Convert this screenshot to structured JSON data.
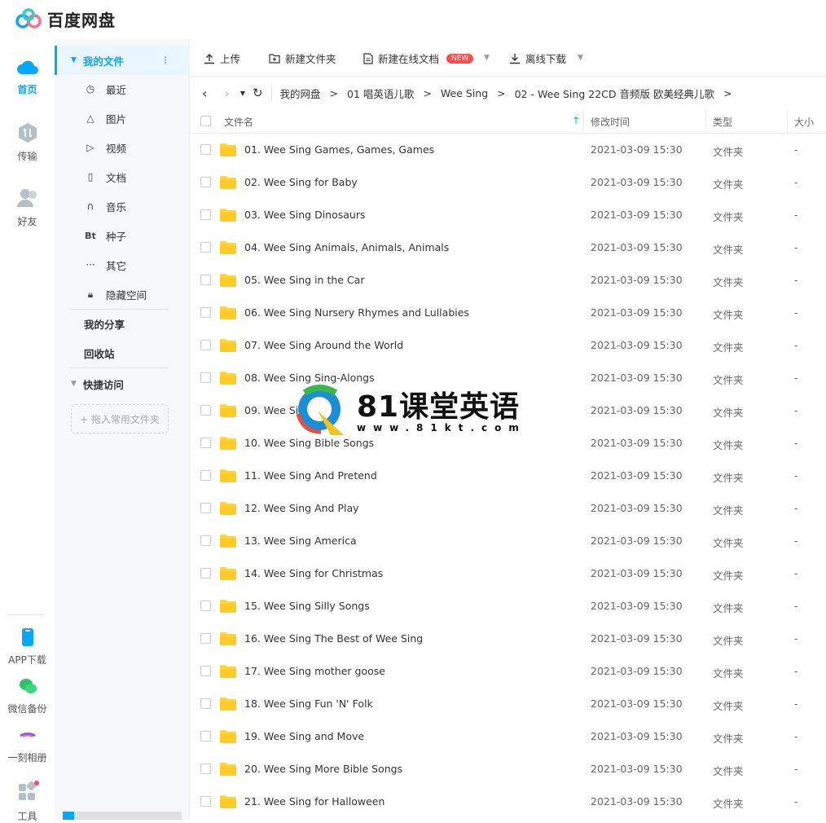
{
  "app": {
    "title": "百度网盘"
  },
  "rail": [
    {
      "name": "home",
      "label": "首页"
    },
    {
      "name": "transfer",
      "label": "传输"
    },
    {
      "name": "friends",
      "label": "好友"
    },
    {
      "name": "app-download",
      "label": "APP下载"
    },
    {
      "name": "wechat-backup",
      "label": "微信备份"
    },
    {
      "name": "moments-album",
      "label": "一刻相册"
    },
    {
      "name": "tools",
      "label": "工具"
    }
  ],
  "sidebar": {
    "my_files": "我的文件",
    "items": [
      {
        "icon": "clock-icon",
        "label": "最近"
      },
      {
        "icon": "image-icon",
        "label": "图片"
      },
      {
        "icon": "video-icon",
        "label": "视频"
      },
      {
        "icon": "document-icon",
        "label": "文档"
      },
      {
        "icon": "headphones-icon",
        "label": "音乐"
      },
      {
        "icon": "torrent-icon",
        "label": "种子",
        "glyph": "Bt"
      },
      {
        "icon": "more-icon",
        "label": "其它"
      },
      {
        "icon": "lock-icon",
        "label": "隐藏空间"
      }
    ],
    "my_share": "我的分享",
    "recycle": "回收站",
    "quick_access": "快捷访问",
    "drop_hint": "+ 拖入常用文件夹"
  },
  "toolbar": {
    "upload": "上传",
    "new_folder": "新建文件夹",
    "new_online_doc": "新建在线文档",
    "new_badge": "NEW",
    "offline_download": "离线下载"
  },
  "breadcrumb": [
    "我的网盘",
    "01 唱英语儿歌",
    "Wee Sing",
    "02 - Wee Sing 22CD 音频版 欧美经典儿歌"
  ],
  "table": {
    "headers": {
      "name": "文件名",
      "modified": "修改时间",
      "type": "类型",
      "size": "大小"
    },
    "rows": [
      {
        "name": "01. Wee Sing Games, Games, Games",
        "modified": "2021-03-09 15:30",
        "type": "文件夹",
        "size": "-"
      },
      {
        "name": "02. Wee Sing for Baby",
        "modified": "2021-03-09 15:30",
        "type": "文件夹",
        "size": "-"
      },
      {
        "name": "03. Wee Sing Dinosaurs",
        "modified": "2021-03-09 15:30",
        "type": "文件夹",
        "size": "-"
      },
      {
        "name": "04. Wee Sing Animals, Animals, Animals",
        "modified": "2021-03-09 15:30",
        "type": "文件夹",
        "size": "-"
      },
      {
        "name": "05. Wee Sing in the Car",
        "modified": "2021-03-09 15:30",
        "type": "文件夹",
        "size": "-"
      },
      {
        "name": "06. Wee Sing Nursery Rhymes and Lullabies",
        "modified": "2021-03-09 15:30",
        "type": "文件夹",
        "size": "-"
      },
      {
        "name": "07. Wee Sing Around the World",
        "modified": "2021-03-09 15:30",
        "type": "文件夹",
        "size": "-"
      },
      {
        "name": "08. Wee Sing Sing-Alongs",
        "modified": "2021-03-09 15:30",
        "type": "文件夹",
        "size": "-"
      },
      {
        "name": "09. Wee Sing",
        "modified": "2021-03-09 15:30",
        "type": "文件夹",
        "size": "-"
      },
      {
        "name": "10. Wee Sing Bible Songs",
        "modified": "2021-03-09 15:30",
        "type": "文件夹",
        "size": "-"
      },
      {
        "name": "11. Wee Sing And Pretend",
        "modified": "2021-03-09 15:30",
        "type": "文件夹",
        "size": "-"
      },
      {
        "name": "12. Wee Sing And Play",
        "modified": "2021-03-09 15:30",
        "type": "文件夹",
        "size": "-"
      },
      {
        "name": "13. Wee Sing America",
        "modified": "2021-03-09 15:30",
        "type": "文件夹",
        "size": "-"
      },
      {
        "name": "14. Wee Sing for Christmas",
        "modified": "2021-03-09 15:30",
        "type": "文件夹",
        "size": "-"
      },
      {
        "name": "15. Wee Sing Silly Songs",
        "modified": "2021-03-09 15:30",
        "type": "文件夹",
        "size": "-"
      },
      {
        "name": "16. Wee Sing The Best of Wee Sing",
        "modified": "2021-03-09 15:30",
        "type": "文件夹",
        "size": "-"
      },
      {
        "name": "17. Wee Sing mother goose",
        "modified": "2021-03-09 15:30",
        "type": "文件夹",
        "size": "-"
      },
      {
        "name": "18. Wee Sing Fun 'N' Folk",
        "modified": "2021-03-09 15:30",
        "type": "文件夹",
        "size": "-"
      },
      {
        "name": "19. Wee Sing and Move",
        "modified": "2021-03-09 15:30",
        "type": "文件夹",
        "size": "-"
      },
      {
        "name": "20. Wee Sing More Bible Songs",
        "modified": "2021-03-09 15:30",
        "type": "文件夹",
        "size": "-"
      },
      {
        "name": "21. Wee Sing for Halloween",
        "modified": "2021-03-09 15:30",
        "type": "文件夹",
        "size": "-"
      }
    ]
  },
  "watermark": {
    "title": "81课堂英语",
    "url": "www.81kt.com"
  },
  "colors": {
    "accent": "#06a7ff",
    "folder": "#ffd43b",
    "badge": "#fa4d4d"
  }
}
